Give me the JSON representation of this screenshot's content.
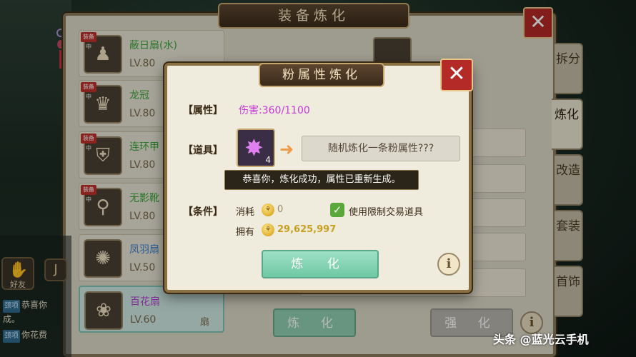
{
  "main": {
    "title": "装备炼化",
    "close": "✕",
    "items": [
      {
        "name": "蔽日扇(水)",
        "level": "LV.80",
        "slot": "",
        "badge": "装备中",
        "color": "green",
        "icon": "fan-icon",
        "glyph": "♟"
      },
      {
        "name": "龙冠",
        "level": "LV.80",
        "slot": "",
        "badge": "装备中",
        "color": "green",
        "icon": "crown-icon",
        "glyph": "♛"
      },
      {
        "name": "连环甲",
        "level": "LV.80",
        "slot": "",
        "badge": "装备中",
        "color": "green",
        "icon": "armor-icon",
        "glyph": "⛨"
      },
      {
        "name": "无影靴",
        "level": "LV.80",
        "slot": "",
        "badge": "装备中",
        "color": "green",
        "icon": "boots-icon",
        "glyph": "⚲"
      },
      {
        "name": "凤羽扇",
        "level": "LV.50",
        "slot": "",
        "badge": "",
        "color": "blue",
        "icon": "feather-fan-icon",
        "glyph": "✺"
      },
      {
        "name": "百花扇",
        "level": "LV.60",
        "slot": "扇",
        "badge": "",
        "color": "purple",
        "icon": "flower-fan-icon",
        "glyph": "❀"
      }
    ],
    "tabs": [
      "拆分",
      "炼化",
      "改造",
      "套装",
      "首饰"
    ],
    "refine_label": "炼 化",
    "enhance_label": "强 化",
    "info": "i"
  },
  "chat": {
    "friend_label": "好友",
    "voice_glyph": "J",
    "lines": [
      {
        "tag": "颈项",
        "text": "恭喜你"
      },
      {
        "text": "成。"
      },
      {
        "tag": "颈项",
        "text": "你花费"
      }
    ]
  },
  "modal": {
    "title": "粉属性炼化",
    "close": "✕",
    "attr_label": "【属性】",
    "attr_value": "伤害:360/1100",
    "prop_label": "【道具】",
    "prop_count": "4",
    "result_text": "随机炼化一条粉属性???",
    "toast": "恭喜你，炼化成功，属性已重新生成。",
    "cond_label": "【条件】",
    "consume_label": "消耗",
    "consume_value": "0",
    "use_restricted_label": "使用限制交易道具",
    "own_label": "拥有",
    "own_value": "29,625,997",
    "refine_button": "炼  化",
    "info": "i"
  },
  "watermark": "头条 @蓝光云手机"
}
